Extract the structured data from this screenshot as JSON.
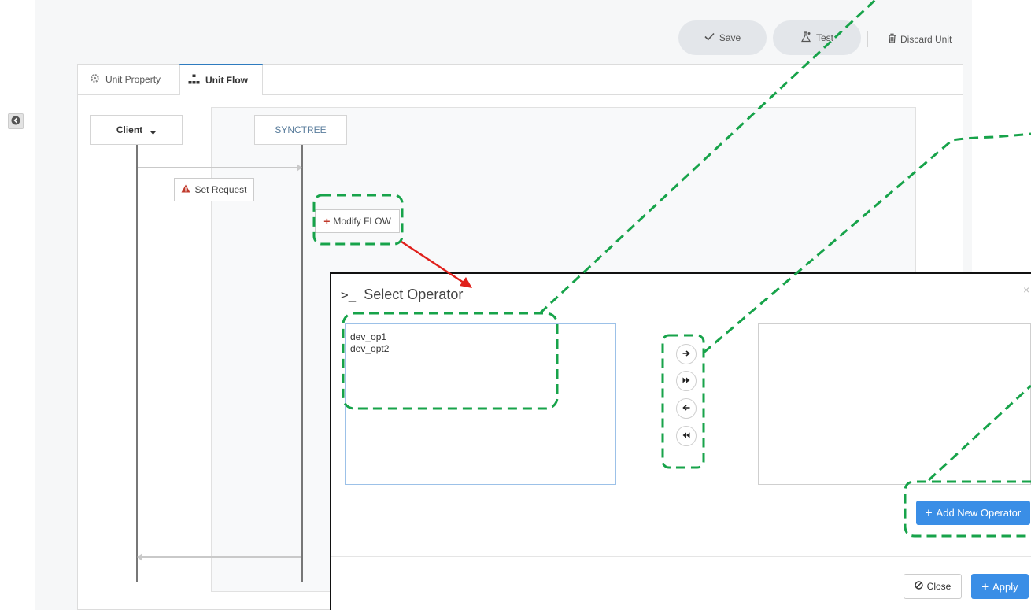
{
  "toolbar": {
    "save_label": "Save",
    "test_label": "Test",
    "discard_label": "Discard Unit"
  },
  "tabs": [
    {
      "label": "Unit Property",
      "icon": "gear-icon",
      "active": false
    },
    {
      "label": "Unit Flow",
      "icon": "sitemap-icon",
      "active": true
    }
  ],
  "flow": {
    "client_label": "Client",
    "synctree_label": "SYNCTREE",
    "set_request_label": "Set Request",
    "modify_flow_label": "Modify FLOW"
  },
  "modal": {
    "prompt": ">_",
    "title": "Select Operator",
    "close_x": "×",
    "available_operators": [
      "dev_op1",
      "dev_opt2"
    ],
    "selected_operators": [],
    "add_new_label": "Add New Operator",
    "close_label": "Close",
    "apply_label": "Apply"
  },
  "colors": {
    "primary": "#3a8ee6",
    "highlight_dash": "#17a34a",
    "pointer_arrow": "#e0201b",
    "active_tab": "#2e7bbf"
  }
}
